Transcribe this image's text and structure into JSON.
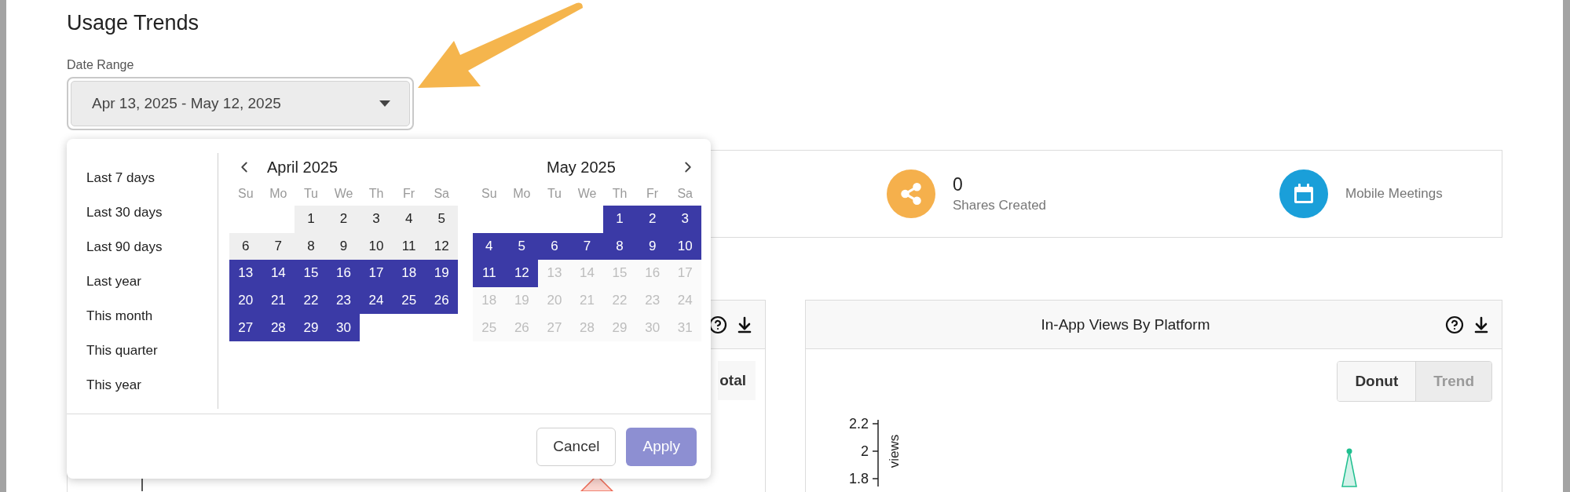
{
  "title": "Usage Trends",
  "date_range": {
    "label": "Date Range",
    "value": "Apr 13, 2025 - May 12, 2025"
  },
  "popup": {
    "presets": [
      {
        "label": "Last 7 days",
        "selected": false
      },
      {
        "label": "Last 30 days",
        "selected": false
      },
      {
        "label": "Last 90 days",
        "selected": false
      },
      {
        "label": "Last year",
        "selected": false
      },
      {
        "label": "This month",
        "selected": false
      },
      {
        "label": "This quarter",
        "selected": false
      },
      {
        "label": "This year",
        "selected": false
      }
    ],
    "months": [
      {
        "title": "April 2025",
        "weekdays": [
          "Su",
          "Mo",
          "Tu",
          "We",
          "Th",
          "Fr",
          "Sa"
        ],
        "weeks": [
          {
            "kind": "leading",
            "days": [
              {
                "day": "1",
                "selected": false,
                "disabled": false
              },
              {
                "day": "2",
                "selected": false,
                "disabled": false
              },
              {
                "day": "3",
                "selected": false,
                "disabled": false
              },
              {
                "day": "4",
                "selected": false,
                "disabled": false
              },
              {
                "day": "5",
                "selected": false,
                "disabled": false
              }
            ]
          },
          {
            "kind": "regular",
            "days": [
              {
                "day": "6",
                "selected": false,
                "disabled": false
              },
              {
                "day": "7",
                "selected": false,
                "disabled": false
              },
              {
                "day": "8",
                "selected": false,
                "disabled": false
              },
              {
                "day": "9",
                "selected": false,
                "disabled": false
              },
              {
                "day": "10",
                "selected": false,
                "disabled": false
              },
              {
                "day": "11",
                "selected": false,
                "disabled": false
              },
              {
                "day": "12",
                "selected": false,
                "disabled": false
              }
            ]
          },
          {
            "kind": "regular",
            "days": [
              {
                "day": "13",
                "selected": true,
                "disabled": false
              },
              {
                "day": "14",
                "selected": true,
                "disabled": false
              },
              {
                "day": "15",
                "selected": true,
                "disabled": false
              },
              {
                "day": "16",
                "selected": true,
                "disabled": false
              },
              {
                "day": "17",
                "selected": true,
                "disabled": false
              },
              {
                "day": "18",
                "selected": true,
                "disabled": false
              },
              {
                "day": "19",
                "selected": true,
                "disabled": false
              }
            ]
          },
          {
            "kind": "regular",
            "days": [
              {
                "day": "20",
                "selected": true,
                "disabled": false
              },
              {
                "day": "21",
                "selected": true,
                "disabled": false
              },
              {
                "day": "22",
                "selected": true,
                "disabled": false
              },
              {
                "day": "23",
                "selected": true,
                "disabled": false
              },
              {
                "day": "24",
                "selected": true,
                "disabled": false
              },
              {
                "day": "25",
                "selected": true,
                "disabled": false
              },
              {
                "day": "26",
                "selected": true,
                "disabled": false
              }
            ]
          },
          {
            "kind": "regular",
            "days": [
              {
                "day": "27",
                "selected": true,
                "disabled": false
              },
              {
                "day": "28",
                "selected": true,
                "disabled": false
              },
              {
                "day": "29",
                "selected": true,
                "disabled": false
              },
              {
                "day": "30",
                "selected": true,
                "disabled": false
              }
            ]
          }
        ]
      },
      {
        "title": "May 2025",
        "weekdays": [
          "Su",
          "Mo",
          "Tu",
          "We",
          "Th",
          "Fr",
          "Sa"
        ],
        "weeks": [
          {
            "kind": "leading",
            "days": [
              {
                "day": "1",
                "selected": true,
                "disabled": false
              },
              {
                "day": "2",
                "selected": true,
                "disabled": false
              },
              {
                "day": "3",
                "selected": true,
                "disabled": false
              }
            ]
          },
          {
            "kind": "regular",
            "days": [
              {
                "day": "4",
                "selected": true,
                "disabled": false
              },
              {
                "day": "5",
                "selected": true,
                "disabled": false
              },
              {
                "day": "6",
                "selected": true,
                "disabled": false
              },
              {
                "day": "7",
                "selected": true,
                "disabled": false
              },
              {
                "day": "8",
                "selected": true,
                "disabled": false
              },
              {
                "day": "9",
                "selected": true,
                "disabled": false
              },
              {
                "day": "10",
                "selected": true,
                "disabled": false
              }
            ]
          },
          {
            "kind": "regular",
            "days": [
              {
                "day": "11",
                "selected": true,
                "disabled": false
              },
              {
                "day": "12",
                "selected": true,
                "disabled": false
              },
              {
                "day": "13",
                "selected": false,
                "disabled": true
              },
              {
                "day": "14",
                "selected": false,
                "disabled": true
              },
              {
                "day": "15",
                "selected": false,
                "disabled": true
              },
              {
                "day": "16",
                "selected": false,
                "disabled": true
              },
              {
                "day": "17",
                "selected": false,
                "disabled": true
              }
            ]
          },
          {
            "kind": "regular",
            "days": [
              {
                "day": "18",
                "selected": false,
                "disabled": true
              },
              {
                "day": "19",
                "selected": false,
                "disabled": true
              },
              {
                "day": "20",
                "selected": false,
                "disabled": true
              },
              {
                "day": "21",
                "selected": false,
                "disabled": true
              },
              {
                "day": "22",
                "selected": false,
                "disabled": true
              },
              {
                "day": "23",
                "selected": false,
                "disabled": true
              },
              {
                "day": "24",
                "selected": false,
                "disabled": true
              }
            ]
          },
          {
            "kind": "regular",
            "days": [
              {
                "day": "25",
                "selected": false,
                "disabled": true
              },
              {
                "day": "26",
                "selected": false,
                "disabled": true
              },
              {
                "day": "27",
                "selected": false,
                "disabled": true
              },
              {
                "day": "28",
                "selected": false,
                "disabled": true
              },
              {
                "day": "29",
                "selected": false,
                "disabled": true
              },
              {
                "day": "30",
                "selected": false,
                "disabled": true
              },
              {
                "day": "31",
                "selected": false,
                "disabled": true
              }
            ]
          }
        ]
      }
    ],
    "buttons": [
      {
        "label": "Cancel",
        "disabled": false
      },
      {
        "label": "Apply",
        "disabled": true
      }
    ]
  },
  "stats": [
    {
      "kind": "share",
      "color": "#f5b04c",
      "value": "0",
      "label": "Shares Created"
    },
    {
      "kind": "calendar",
      "color": "#1a9fd9",
      "label": "Mobile Meetings"
    }
  ],
  "charts": [
    {
      "toggle": [
        {
          "label": "otal",
          "selected": false
        }
      ]
    },
    {
      "title": "In-App Views By Platform",
      "toggle": [
        {
          "label": "Donut",
          "selected": false
        },
        {
          "label": "Trend",
          "selected": true
        }
      ],
      "y_axis": {
        "label": "views",
        "ticks": [
          "2.2",
          "2",
          "1.8"
        ]
      }
    }
  ]
}
